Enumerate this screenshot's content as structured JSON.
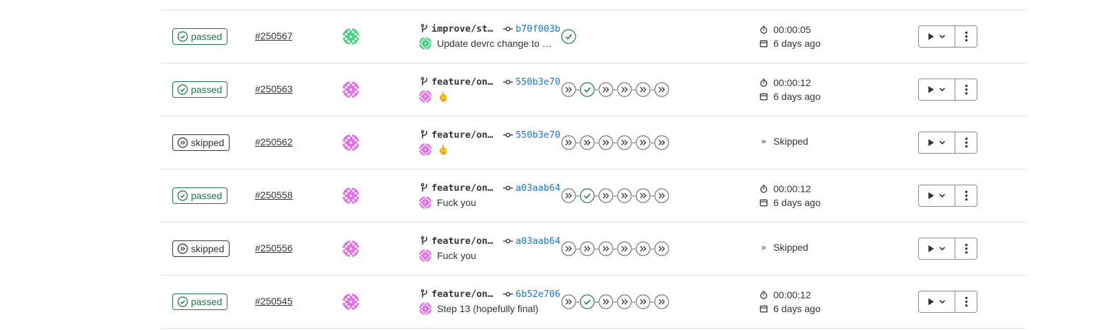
{
  "colors": {
    "passed": "#217645",
    "skipped": "#333238",
    "link": "#1f75cb",
    "border": "#dcdcde",
    "avatar_green": "#3fd37d",
    "avatar_pink": "#e56be8"
  },
  "pipelines": [
    {
      "status": "passed",
      "status_label": "passed",
      "id": "#250567",
      "avatar": "green",
      "branch": "improve/stg…",
      "sha": "b70f003b",
      "commit_title": "Update devrc change to …",
      "stages": [
        "passed"
      ],
      "duration": "00:00:05",
      "finished": "6 days ago",
      "skipped_label": ""
    },
    {
      "status": "passed",
      "status_label": "passed",
      "id": "#250563",
      "avatar": "pink",
      "branch": "feature/onp…",
      "sha": "550b3e70",
      "commit_title": "🖕",
      "stages": [
        "skipped",
        "passed",
        "skipped",
        "skipped",
        "skipped",
        "skipped"
      ],
      "duration": "00:00:12",
      "finished": "6 days ago",
      "skipped_label": ""
    },
    {
      "status": "skipped",
      "status_label": "skipped",
      "id": "#250562",
      "avatar": "pink",
      "branch": "feature/onp…",
      "sha": "550b3e70",
      "commit_title": "🖕",
      "stages": [
        "skipped",
        "skipped",
        "skipped",
        "skipped",
        "skipped",
        "skipped"
      ],
      "duration": "",
      "finished": "",
      "skipped_label": "Skipped"
    },
    {
      "status": "passed",
      "status_label": "passed",
      "id": "#250558",
      "avatar": "pink",
      "branch": "feature/onp…",
      "sha": "a03aab64",
      "commit_title": "Fuck you",
      "stages": [
        "skipped",
        "passed",
        "skipped",
        "skipped",
        "skipped",
        "skipped"
      ],
      "duration": "00:00:12",
      "finished": "6 days ago",
      "skipped_label": ""
    },
    {
      "status": "skipped",
      "status_label": "skipped",
      "id": "#250556",
      "avatar": "pink",
      "branch": "feature/onp…",
      "sha": "a03aab64",
      "commit_title": "Fuck you",
      "stages": [
        "skipped",
        "skipped",
        "skipped",
        "skipped",
        "skipped",
        "skipped"
      ],
      "duration": "",
      "finished": "",
      "skipped_label": "Skipped"
    },
    {
      "status": "passed",
      "status_label": "passed",
      "id": "#250545",
      "avatar": "pink",
      "branch": "feature/onp…",
      "sha": "6b52e706",
      "commit_title": "Step 13 (hopefully final)",
      "stages": [
        "skipped",
        "passed",
        "skipped",
        "skipped",
        "skipped",
        "skipped"
      ],
      "duration": "00:00:12",
      "finished": "6 days ago",
      "skipped_label": ""
    }
  ]
}
